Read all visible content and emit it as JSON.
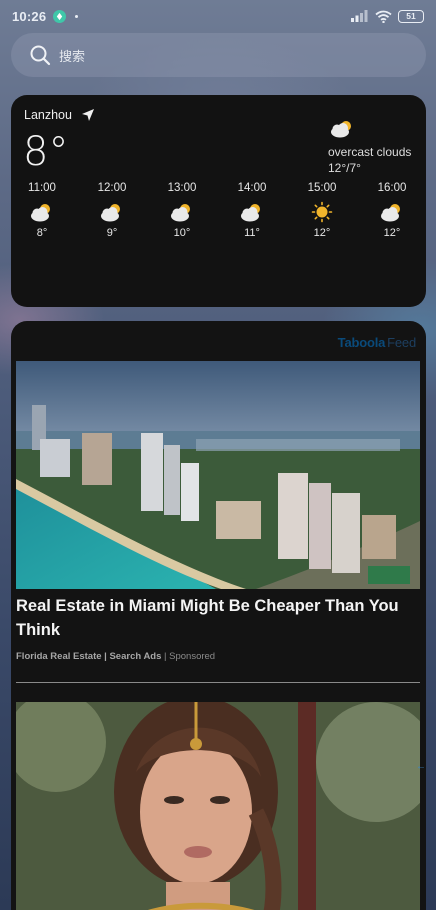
{
  "status_bar": {
    "time": "10:26",
    "battery": "51"
  },
  "search": {
    "placeholder": "搜索"
  },
  "weather": {
    "city": "Lanzhou",
    "current_temp": "8°",
    "condition": "overcast clouds",
    "range": "12°/7°",
    "hourly": [
      {
        "time": "11:00",
        "temp": "8°",
        "icon": "partly-cloudy-icon"
      },
      {
        "time": "12:00",
        "temp": "9°",
        "icon": "partly-cloudy-icon"
      },
      {
        "time": "13:00",
        "temp": "10°",
        "icon": "partly-cloudy-icon"
      },
      {
        "time": "14:00",
        "temp": "11°",
        "icon": "partly-cloudy-icon"
      },
      {
        "time": "15:00",
        "temp": "12°",
        "icon": "sun-icon"
      },
      {
        "time": "16:00",
        "temp": "12°",
        "icon": "partly-cloudy-icon"
      }
    ]
  },
  "feed": {
    "brand": "Taboola",
    "brand_suffix": "Feed",
    "ads": [
      {
        "title": "Real Estate in Miami Might Be Cheaper Than You Think",
        "source": "Florida Real Estate | Search Ads",
        "sponsored": "Sponsored"
      }
    ]
  },
  "colors": {
    "card_bg": "#121212",
    "accent_teal": "#3fc7a9",
    "taboola_blue": "#0a4a7a"
  }
}
